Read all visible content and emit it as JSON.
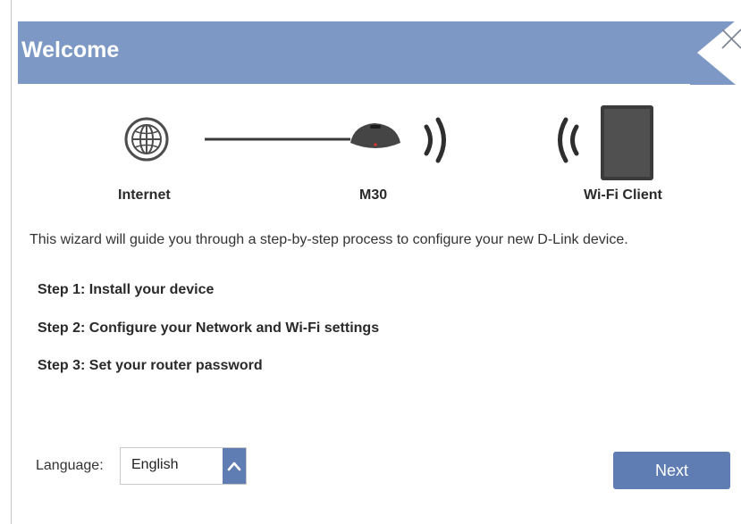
{
  "header": {
    "title": "Welcome",
    "close_icon": "close-icon",
    "banner_color": "#7d98c4"
  },
  "diagram": {
    "internet_label": "Internet",
    "router_label": "M30",
    "client_label": "Wi-Fi Client",
    "icons": [
      "globe-icon",
      "router-icon",
      "wifi-signal-icon",
      "tablet-icon"
    ]
  },
  "content": {
    "intro": "This wizard will guide you through a step-by-step process to configure your new D-Link device.",
    "steps": [
      "Step 1: Install your device",
      "Step 2: Configure your Network and Wi-Fi settings",
      "Step 3: Set your router password"
    ]
  },
  "footer": {
    "language_label": "Language:",
    "language_value": "English",
    "next_label": "Next",
    "button_color": "#5f7cb3"
  }
}
